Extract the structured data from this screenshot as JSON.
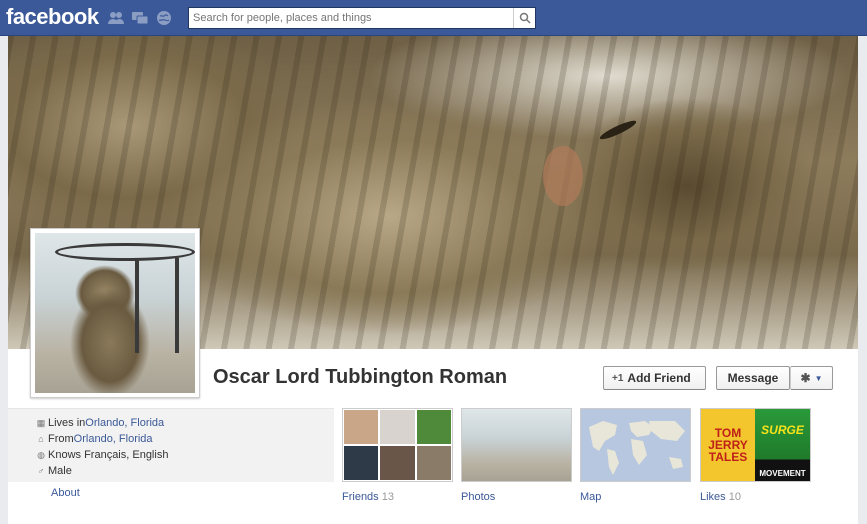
{
  "topbar": {
    "logo": "facebook",
    "search_placeholder": "Search for people, places and things",
    "icons": [
      "friend-requests-icon",
      "messages-icon",
      "notifications-icon",
      "search-icon"
    ]
  },
  "profile": {
    "name": "Oscar Lord Tubbington Roman",
    "add_friend_label": "Add Friend",
    "message_label": "Message"
  },
  "info": {
    "lives_in_prefix": "Lives in ",
    "lives_in_value": "Orlando, Florida",
    "from_prefix": "From ",
    "from_value": "Orlando, Florida",
    "knows": "Knows Français, English",
    "gender": "Male",
    "about_link": "About"
  },
  "tiles": {
    "friends_label": "Friends",
    "friends_count": "13",
    "photos_label": "Photos",
    "map_label": "Map",
    "likes_label": "Likes",
    "likes_count": "10",
    "likes_page_a": "TOM JERRY TALES",
    "likes_page_b_title": "SURGE",
    "likes_page_b_sub": "MOVEMENT"
  },
  "colors": {
    "brand": "#3b5998",
    "link": "#3b5998",
    "page_bg": "#e9ebee"
  }
}
